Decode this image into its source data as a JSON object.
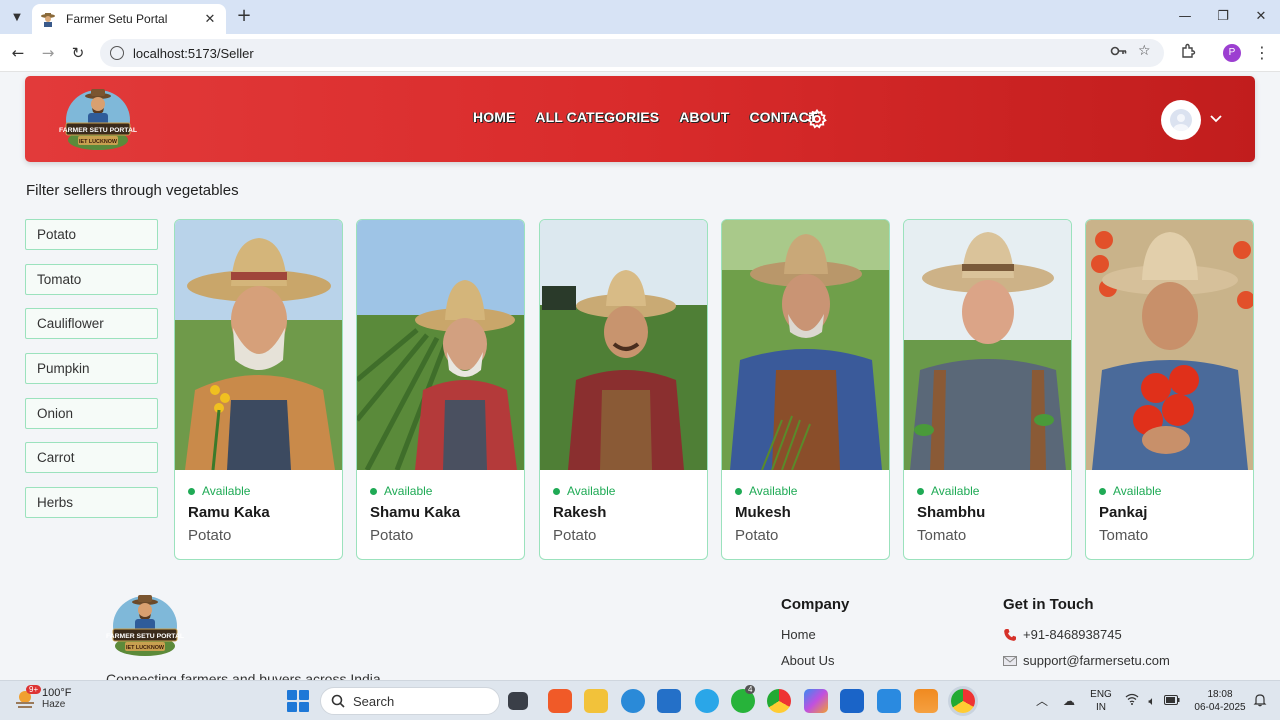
{
  "browser": {
    "tab_title": "Farmer Setu Portal",
    "url": "localhost:5173/Seller",
    "profile_initial": "P"
  },
  "brand": {
    "logo_text": "FARMER SETU PORTAL",
    "logo_subtext": "IET LUCKNOW"
  },
  "nav": {
    "home": "HOME",
    "categories": "ALL CATEGORIES",
    "about": "ABOUT",
    "contact": "CONTACT"
  },
  "filter": {
    "title": "Filter sellers through vegetables",
    "items": [
      "Potato",
      "Tomato",
      "Cauliflower",
      "Pumpkin",
      "Onion",
      "Carrot",
      "Herbs"
    ]
  },
  "sellers": [
    {
      "status": "Available",
      "name": "Ramu Kaka",
      "vegetable": "Potato"
    },
    {
      "status": "Available",
      "name": "Shamu Kaka",
      "vegetable": "Potato"
    },
    {
      "status": "Available",
      "name": "Rakesh",
      "vegetable": "Potato"
    },
    {
      "status": "Available",
      "name": "Mukesh",
      "vegetable": "Potato"
    },
    {
      "status": "Available",
      "name": "Shambhu",
      "vegetable": "Tomato"
    },
    {
      "status": "Available",
      "name": "Pankaj",
      "vegetable": "Tomato"
    }
  ],
  "footer": {
    "company_title": "Company",
    "company_links": [
      "Home",
      "About Us"
    ],
    "contact_title": "Get in Touch",
    "phone": "+91-8468938745",
    "email": "support@farmersetu.com",
    "tagline": "Connecting farmers and buyers across India"
  },
  "taskbar": {
    "weather_temp": "100°F",
    "weather_desc": "Haze",
    "weather_badge": "9+",
    "search_placeholder": "Search",
    "lang_top": "ENG",
    "lang_bottom": "IN",
    "time": "18:08",
    "date": "06-04-2025",
    "whatsapp_badge": "4"
  },
  "colors": {
    "header_start": "#e23a3a",
    "header_end": "#c11d1d",
    "available_green": "#1faa55",
    "card_border": "#9be2bd"
  }
}
